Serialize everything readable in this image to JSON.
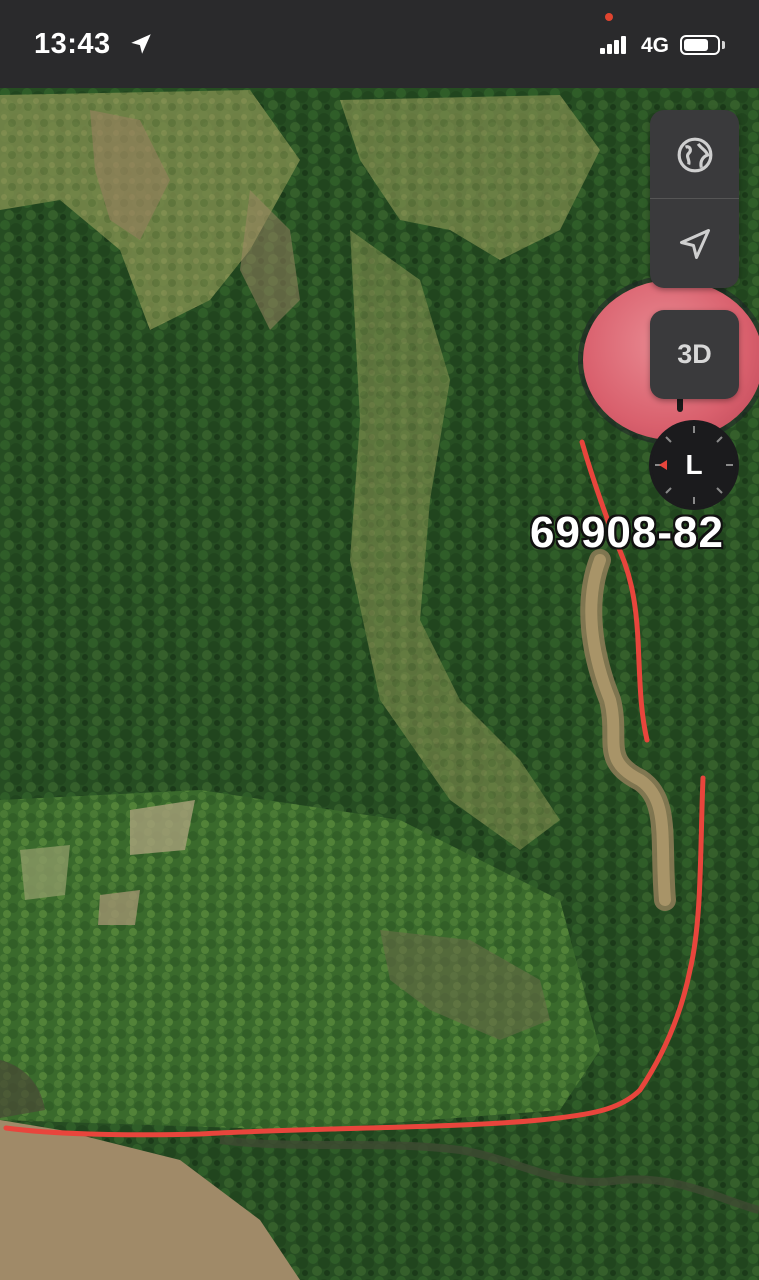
{
  "status_bar": {
    "time": "13:43",
    "network": "4G",
    "battery_level": 0.75,
    "icons": [
      "location-arrow-icon",
      "signal-icon",
      "battery-icon"
    ]
  },
  "map": {
    "view": "satellite",
    "place_label": "69908-82",
    "route_color": "#e8453c",
    "controls": {
      "globe": "globe-icon",
      "locate": "location-icon",
      "three_d": "3D",
      "compass_letter": "L"
    },
    "pin_color": "#d9606d"
  }
}
